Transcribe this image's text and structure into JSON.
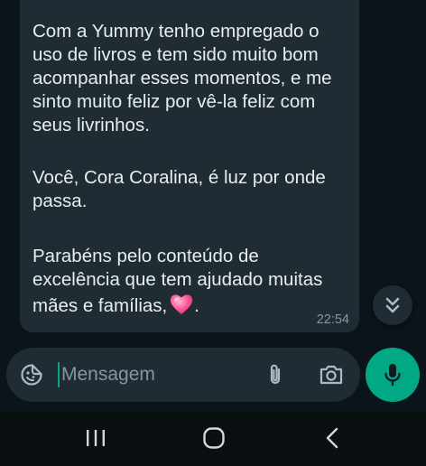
{
  "message": {
    "paragraphs": [
      "Com a Yummy tenho empregado o uso de livros e tem sido muito bom acompanhar esses momentos, e me sinto muito feliz por vê-la feliz com seus livrinhos.",
      "Você, Cora Coralina, é luz por onde passa.",
      "Parabéns pelo conteúdo de excelência que tem ajudado muitas mães e famílias,"
    ],
    "trailing_punct": ".",
    "emoji": "pink-heart",
    "time": "22:54"
  },
  "composer": {
    "placeholder": "Mensagem",
    "icons": [
      "sticker-emoji-icon",
      "paperclip-icon",
      "camera-icon",
      "microphone-icon"
    ]
  },
  "scroll_button": {
    "icon": "double-chevron-down-icon"
  },
  "navbar": {
    "icons": [
      "recents-icon",
      "home-icon",
      "back-icon"
    ]
  },
  "colors": {
    "background": "#0b141a",
    "bubble": "#1f2c34",
    "text": "#e9edef",
    "muted": "#8696a0",
    "accent": "#00a884"
  }
}
